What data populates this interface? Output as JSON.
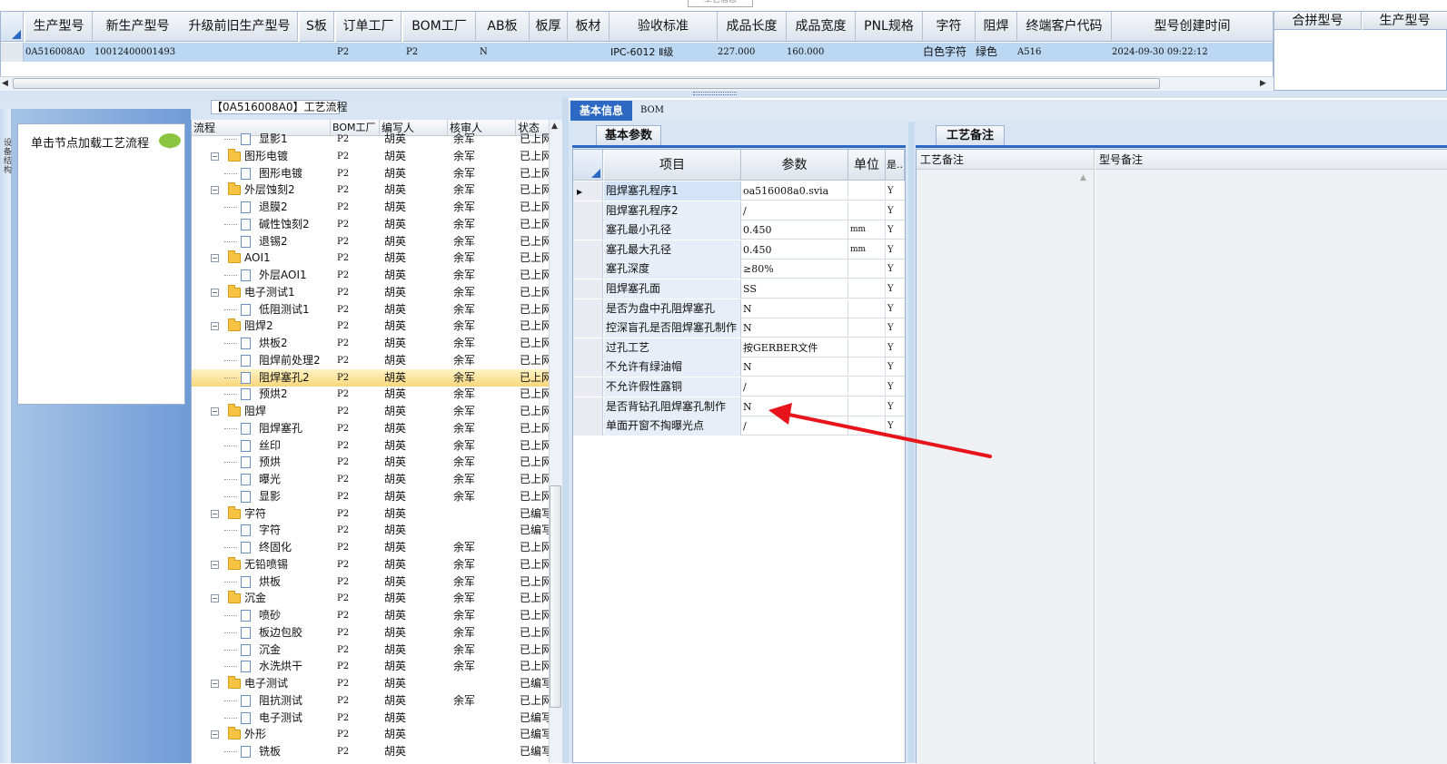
{
  "window": {
    "top_tab_label": "工艺信息"
  },
  "top_grid": {
    "headers": [
      "生产型号",
      "新生产型号",
      "升级前旧生产型号",
      "S板",
      "订单工厂",
      "BOM工厂",
      "AB板",
      "板厚",
      "板材",
      "验收标准",
      "成品长度",
      "成品宽度",
      "PNL规格",
      "字符",
      "阻焊",
      "终端客户代码",
      "型号创建时间"
    ],
    "row": {
      "生产型号": "0A516008A0",
      "新生产型号": "10012400001493",
      "订单工厂": "P2",
      "BOM工厂": "P2",
      "AB板": "N",
      "验收标准": "IPC-6012 Ⅱ级",
      "成品长度": "227.000",
      "成品宽度": "160.000",
      "字符": "白色字符",
      "阻焊": "绿色",
      "终端客户代码": "A516",
      "型号创建时间": "2024-09-30 09:22:12"
    }
  },
  "merge_grid": {
    "headers": [
      "合拼型号",
      "生产型号"
    ]
  },
  "left_panel": {
    "sidebar_label": "设备结构",
    "node_hint": "单击节点加载工艺流程",
    "flow_title": "【0A516008A0】工艺流程"
  },
  "tree": {
    "headers": [
      "流程",
      "BOM工厂",
      "编写人",
      "核审人",
      "状态"
    ],
    "rows": [
      {
        "level": 2,
        "name": "显影1",
        "bom": "P2",
        "writer": "胡英",
        "reviewer": "余军",
        "status": "已上网"
      },
      {
        "level": 1,
        "name": "图形电镀",
        "bom": "P2",
        "writer": "胡英",
        "reviewer": "余军",
        "status": "已上网"
      },
      {
        "level": 2,
        "name": "图形电镀",
        "bom": "P2",
        "writer": "胡英",
        "reviewer": "余军",
        "status": "已上网"
      },
      {
        "level": 1,
        "name": "外层蚀刻2",
        "bom": "P2",
        "writer": "胡英",
        "reviewer": "余军",
        "status": "已上网"
      },
      {
        "level": 2,
        "name": "退膜2",
        "bom": "P2",
        "writer": "胡英",
        "reviewer": "余军",
        "status": "已上网"
      },
      {
        "level": 2,
        "name": "碱性蚀刻2",
        "bom": "P2",
        "writer": "胡英",
        "reviewer": "余军",
        "status": "已上网"
      },
      {
        "level": 2,
        "name": "退锡2",
        "bom": "P2",
        "writer": "胡英",
        "reviewer": "余军",
        "status": "已上网"
      },
      {
        "level": 1,
        "name": "AOI1",
        "bom": "P2",
        "writer": "胡英",
        "reviewer": "余军",
        "status": "已上网"
      },
      {
        "level": 2,
        "name": "外层AOI1",
        "bom": "P2",
        "writer": "胡英",
        "reviewer": "余军",
        "status": "已上网"
      },
      {
        "level": 1,
        "name": "电子测试1",
        "bom": "P2",
        "writer": "胡英",
        "reviewer": "余军",
        "status": "已上网"
      },
      {
        "level": 2,
        "name": "低阻测试1",
        "bom": "P2",
        "writer": "胡英",
        "reviewer": "余军",
        "status": "已上网"
      },
      {
        "level": 1,
        "name": "阻焊2",
        "bom": "P2",
        "writer": "胡英",
        "reviewer": "余军",
        "status": "已上网"
      },
      {
        "level": 2,
        "name": "烘板2",
        "bom": "P2",
        "writer": "胡英",
        "reviewer": "余军",
        "status": "已上网"
      },
      {
        "level": 2,
        "name": "阻焊前处理2",
        "bom": "P2",
        "writer": "胡英",
        "reviewer": "余军",
        "status": "已上网"
      },
      {
        "level": 2,
        "name": "阻焊塞孔2",
        "bom": "P2",
        "writer": "胡英",
        "reviewer": "余军",
        "status": "已上网",
        "selected": true
      },
      {
        "level": 2,
        "name": "预烘2",
        "bom": "P2",
        "writer": "胡英",
        "reviewer": "余军",
        "status": "已上网"
      },
      {
        "level": 1,
        "name": "阻焊",
        "bom": "P2",
        "writer": "胡英",
        "reviewer": "余军",
        "status": "已上网"
      },
      {
        "level": 2,
        "name": "阻焊塞孔",
        "bom": "P2",
        "writer": "胡英",
        "reviewer": "余军",
        "status": "已上网"
      },
      {
        "level": 2,
        "name": "丝印",
        "bom": "P2",
        "writer": "胡英",
        "reviewer": "余军",
        "status": "已上网"
      },
      {
        "level": 2,
        "name": "预烘",
        "bom": "P2",
        "writer": "胡英",
        "reviewer": "余军",
        "status": "已上网"
      },
      {
        "level": 2,
        "name": "曝光",
        "bom": "P2",
        "writer": "胡英",
        "reviewer": "余军",
        "status": "已上网"
      },
      {
        "level": 2,
        "name": "显影",
        "bom": "P2",
        "writer": "胡英",
        "reviewer": "余军",
        "status": "已上网"
      },
      {
        "level": 1,
        "name": "字符",
        "bom": "P2",
        "writer": "胡英",
        "reviewer": "",
        "status": "已编写"
      },
      {
        "level": 2,
        "name": "字符",
        "bom": "P2",
        "writer": "胡英",
        "reviewer": "",
        "status": "已编写"
      },
      {
        "level": 2,
        "name": "终固化",
        "bom": "P2",
        "writer": "胡英",
        "reviewer": "余军",
        "status": "已上网"
      },
      {
        "level": 1,
        "name": "无铅喷锡",
        "bom": "P2",
        "writer": "胡英",
        "reviewer": "余军",
        "status": "已上网"
      },
      {
        "level": 2,
        "name": "烘板",
        "bom": "P2",
        "writer": "胡英",
        "reviewer": "余军",
        "status": "已上网"
      },
      {
        "level": 1,
        "name": "沉金",
        "bom": "P2",
        "writer": "胡英",
        "reviewer": "余军",
        "status": "已上网"
      },
      {
        "level": 2,
        "name": "喷砂",
        "bom": "P2",
        "writer": "胡英",
        "reviewer": "余军",
        "status": "已上网"
      },
      {
        "level": 2,
        "name": "板边包胶",
        "bom": "P2",
        "writer": "胡英",
        "reviewer": "余军",
        "status": "已上网"
      },
      {
        "level": 2,
        "name": "沉金",
        "bom": "P2",
        "writer": "胡英",
        "reviewer": "余军",
        "status": "已上网"
      },
      {
        "level": 2,
        "name": "水洗烘干",
        "bom": "P2",
        "writer": "胡英",
        "reviewer": "余军",
        "status": "已上网"
      },
      {
        "level": 1,
        "name": "电子测试",
        "bom": "P2",
        "writer": "胡英",
        "reviewer": "",
        "status": "已编写"
      },
      {
        "level": 2,
        "name": "阻抗测试",
        "bom": "P2",
        "writer": "胡英",
        "reviewer": "余军",
        "status": "已上网"
      },
      {
        "level": 2,
        "name": "电子测试",
        "bom": "P2",
        "writer": "胡英",
        "reviewer": "",
        "status": "已编写"
      },
      {
        "level": 1,
        "name": "外形",
        "bom": "P2",
        "writer": "胡英",
        "reviewer": "",
        "status": "已编写"
      },
      {
        "level": 2,
        "name": "铣板",
        "bom": "P2",
        "writer": "胡英",
        "reviewer": "",
        "status": "已编写"
      }
    ]
  },
  "middle": {
    "tab_basic": "基本信息",
    "tab_bom": "BOM",
    "subtab": "基本参数",
    "param_headers": [
      "项目",
      "参数",
      "单位",
      "是.."
    ],
    "params": [
      {
        "item": "阻焊塞孔程序1",
        "value": "oa516008a0.svia",
        "unit": "",
        "flag": "Y"
      },
      {
        "item": "阻焊塞孔程序2",
        "value": "/",
        "unit": "",
        "flag": "Y"
      },
      {
        "item": "塞孔最小孔径",
        "value": "0.450",
        "unit": "mm",
        "flag": "Y"
      },
      {
        "item": "塞孔最大孔径",
        "value": "0.450",
        "unit": "mm",
        "flag": "Y"
      },
      {
        "item": "塞孔深度",
        "value": "≥80%",
        "unit": "",
        "flag": "Y"
      },
      {
        "item": "阻焊塞孔面",
        "value": "SS",
        "unit": "",
        "flag": "Y"
      },
      {
        "item": "是否为盘中孔阻焊塞孔",
        "value": "N",
        "unit": "",
        "flag": "Y"
      },
      {
        "item": "控深盲孔是否阻焊塞孔制作",
        "value": "N",
        "unit": "",
        "flag": "Y"
      },
      {
        "item": "过孔工艺",
        "value": "按GERBER文件",
        "unit": "",
        "flag": "Y"
      },
      {
        "item": "不允许有绿油帽",
        "value": "N",
        "unit": "",
        "flag": "Y"
      },
      {
        "item": "不允许假性露铜",
        "value": "/",
        "unit": "",
        "flag": "Y"
      },
      {
        "item": "是否背钻孔阻焊塞孔制作",
        "value": "N",
        "unit": "",
        "flag": "Y"
      },
      {
        "item": "单面开窗不掏曝光点",
        "value": "/",
        "unit": "",
        "flag": "Y"
      }
    ]
  },
  "right": {
    "subtab": "工艺备注",
    "col1": "工艺备注",
    "col2": "型号备注"
  },
  "annotation": {
    "arrow_color": "#e8141c"
  }
}
